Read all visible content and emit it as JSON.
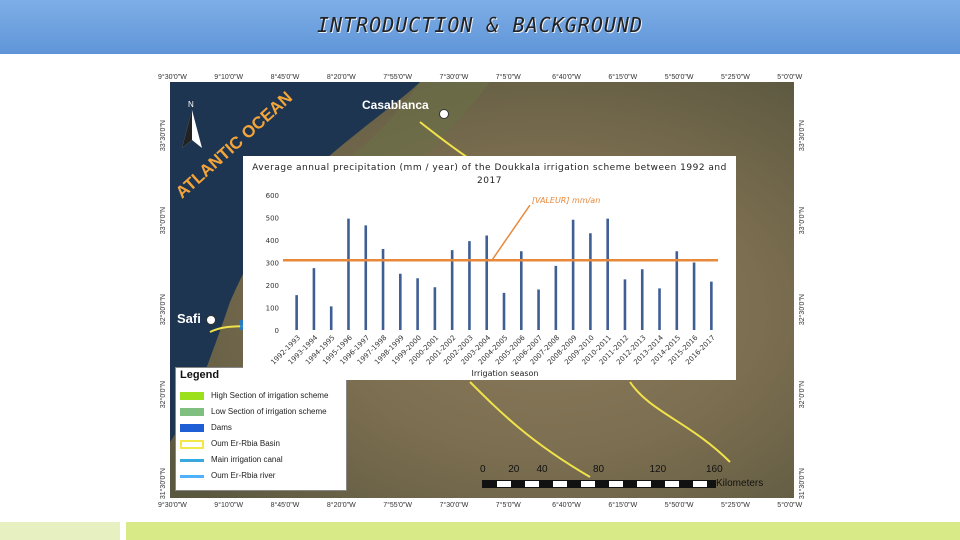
{
  "slide": {
    "title": "INTRODUCTION & BACKGROUND"
  },
  "map": {
    "top_coords": [
      "9°30'0\"W",
      "9°10'0\"W",
      "8°45'0\"W",
      "8°20'0\"W",
      "7°55'0\"W",
      "7°30'0\"W",
      "7°5'0\"W",
      "6°40'0\"W",
      "6°15'0\"W",
      "5°50'0\"W",
      "5°25'0\"W",
      "5°0'0\"W"
    ],
    "left_coords": [
      "33°30'0\"N",
      "33°0'0\"N",
      "32°30'0\"N",
      "32°0'0\"N",
      "31°30'0\"N"
    ],
    "cities": {
      "casablanca": "Casablanca",
      "safi": "Safi"
    },
    "ocean_label": "ATLANTIC OCEAN",
    "north_label": "N",
    "legend": {
      "title": "Legend",
      "items": [
        {
          "label": "High Section of irrigation scheme",
          "color": "#9be01a"
        },
        {
          "label": "Low Section of irrigation scheme",
          "color": "#7fbf7f"
        },
        {
          "label": "Dams",
          "color": "#1f5fd6"
        },
        {
          "label": "Oum Er-Rbia Basin",
          "color": "#f2e84a"
        },
        {
          "label": "Main irrigation canal",
          "color": "#3aa8e0"
        },
        {
          "label": "Oum Er-Rbia river",
          "color": "#4fb0ff"
        }
      ]
    },
    "scale": {
      "ticks": [
        "0",
        "20",
        "40",
        "80",
        "120",
        "160"
      ],
      "unit": "Kilometers"
    }
  },
  "chart_data": {
    "type": "bar",
    "title": "Average annual precipitation (mm / year) of the Doukkala irrigation scheme between 1992 and 2017",
    "xlabel": "Irrigation season",
    "ylabel": "",
    "ylim": [
      0,
      600
    ],
    "yticks": [
      0,
      100,
      200,
      300,
      400,
      500,
      600
    ],
    "categories": [
      "1992-1993",
      "1993-1994",
      "1994-1995",
      "1995-1996",
      "1996-1997",
      "1997-1998",
      "1998-1999",
      "1999-2000",
      "2000-2001",
      "2001-2002",
      "2002-2003",
      "2003-2004",
      "2004-2005",
      "2005-2006",
      "2006-2007",
      "2007-2008",
      "2008-2009",
      "2009-2010",
      "2010-2011",
      "2011-2012",
      "2012-2013",
      "2013-2014",
      "2014-2015",
      "2015-2016",
      "2016-2017"
    ],
    "values": [
      155,
      275,
      105,
      495,
      465,
      360,
      250,
      230,
      190,
      355,
      395,
      420,
      165,
      350,
      180,
      285,
      490,
      430,
      495,
      225,
      270,
      185,
      350,
      300,
      215
    ],
    "average_line": 310,
    "average_label": "[VALEUR] mm/an",
    "colors": {
      "bars": "#3f5e94",
      "average": "#e8883a"
    },
    "grid": false
  }
}
